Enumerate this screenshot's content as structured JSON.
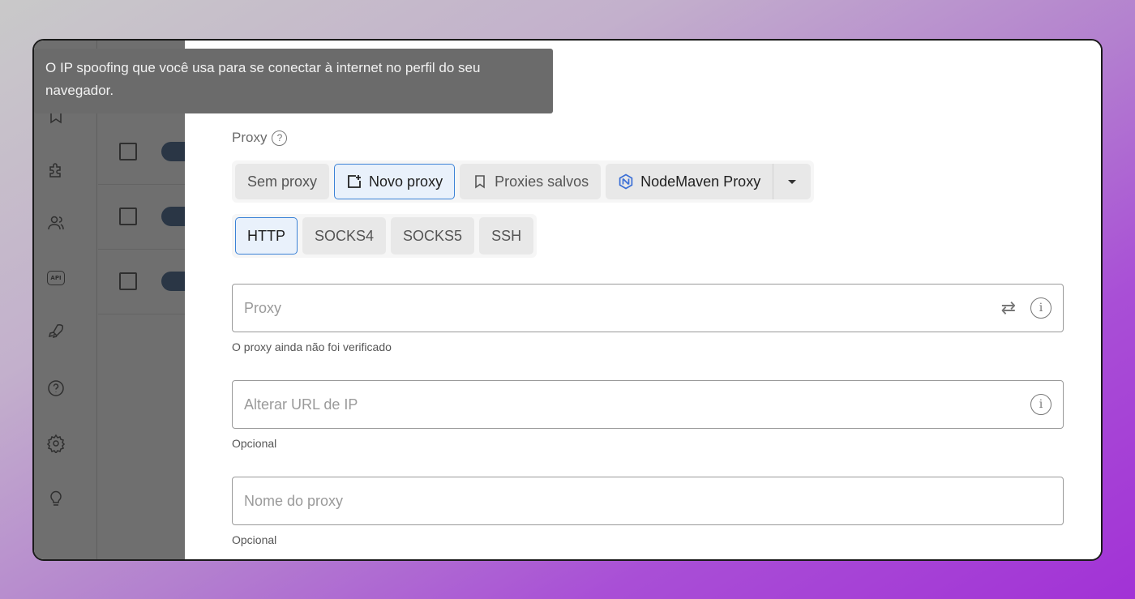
{
  "tooltip": {
    "text": "O IP spoofing que você usa para se conectar à internet no perfil do seu navegador."
  },
  "proxy_section": {
    "label": "Proxy",
    "help_glyph": "?",
    "sources": [
      {
        "label": "Sem proxy",
        "icon": null,
        "active": false
      },
      {
        "label": "Novo proxy",
        "icon": "add-box-icon",
        "active": true
      },
      {
        "label": "Proxies salvos",
        "icon": "bookmark-icon",
        "active": false
      },
      {
        "label": "NodeMaven Proxy",
        "icon": "nodemaven-logo-icon",
        "active": false
      }
    ],
    "dropdown_icon": "caret-down-icon",
    "protocols": [
      {
        "label": "HTTP",
        "active": true
      },
      {
        "label": "SOCKS4",
        "active": false
      },
      {
        "label": "SOCKS5",
        "active": false
      },
      {
        "label": "SSH",
        "active": false
      }
    ]
  },
  "fields": {
    "proxy": {
      "placeholder": "Proxy",
      "value": "",
      "helper": "O proxy ainda não foi verificado",
      "icons": [
        "swap-icon",
        "info-icon"
      ]
    },
    "change_ip_url": {
      "placeholder": "Alterar URL de IP",
      "value": "",
      "helper": "Opcional",
      "icons": [
        "info-icon"
      ]
    },
    "proxy_name": {
      "placeholder": "Nome do proxy",
      "value": "",
      "helper": "Opcional"
    }
  },
  "colors": {
    "accent": "#3b82d6",
    "nodemaven": "#3b6fd6",
    "overlay": "#6f6f6f"
  },
  "sidebar_icons": [
    "bookmark-icon",
    "puzzle-icon",
    "users-icon",
    "api-icon",
    "rocket-icon",
    "help-icon",
    "settings-icon",
    "lightbulb-icon"
  ],
  "api_badge_text": "API",
  "info_glyph": "i",
  "swap_glyph": "⇄"
}
